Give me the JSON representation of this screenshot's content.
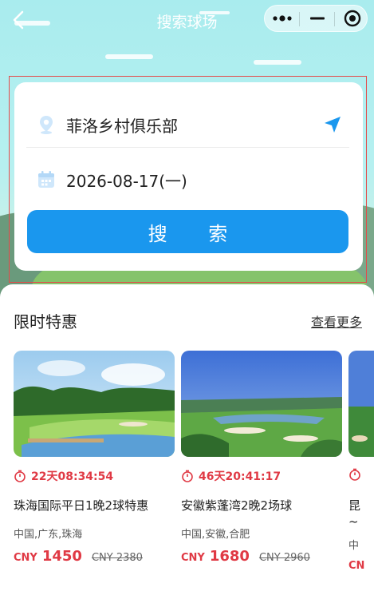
{
  "nav": {
    "title": "搜索球场"
  },
  "search": {
    "location": "菲洛乡村俱乐部",
    "date": "2026-08-17(一)",
    "button_label": "搜 索"
  },
  "deals": {
    "title": "限时特惠",
    "more_label": "查看更多",
    "items": [
      {
        "countdown": "22天08:34:54",
        "name": "珠海国际平日1晚2球特惠",
        "region": "中国,广东,珠海",
        "currency": "CNY",
        "price": "1450",
        "old_price": "CNY 2380"
      },
      {
        "countdown": "46天20:41:17",
        "name": "安徽紫蓬湾2晚2场球",
        "region": "中国,安徽,合肥",
        "currency": "CNY",
        "price": "1680",
        "old_price": "CNY 2960"
      },
      {
        "name": "昆",
        "name_line2": "~",
        "region": "中",
        "currency": "CN"
      }
    ]
  },
  "colors": {
    "accent": "#1a97ee",
    "countdown": "#e03a45",
    "price": "#e03a45",
    "focus_border": "#e44a4a"
  },
  "icons": {
    "back": "chevron-left-icon",
    "more": "more-dots-icon",
    "minimize": "minimize-icon",
    "close": "target-icon",
    "location": "location-pin-icon",
    "locate": "navigation-arrow-icon",
    "calendar": "calendar-icon",
    "timer": "stopwatch-icon"
  }
}
